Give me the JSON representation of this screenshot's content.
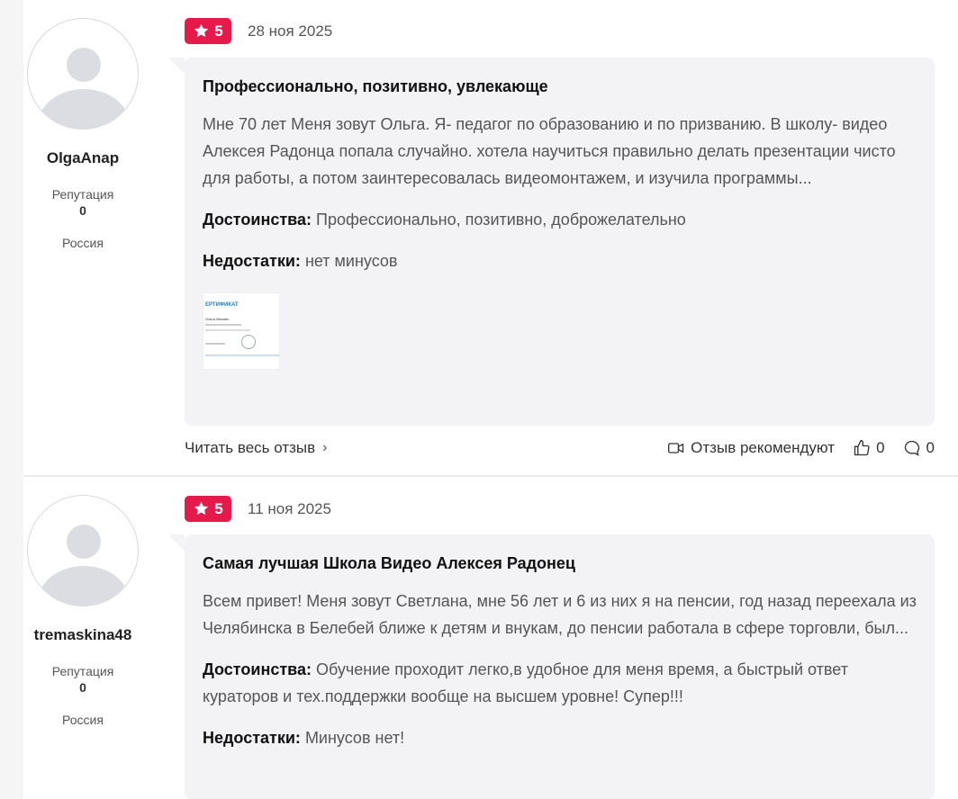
{
  "reviews": [
    {
      "username": "OlgaAnap",
      "reputation_label": "Репутация",
      "reputation_value": "0",
      "country": "Россия",
      "rating": "5",
      "date": "28 ноя 2025",
      "title": "Профессионально, позитивно, увлекающе",
      "text": "Мне 70 лет Меня зовут Ольга. Я- педагог по образованию и по призванию. В школу- видео Алексея Радонца попала случайно. хотела научиться правильно делать презентации чисто для работы, а потом заинтересовалась видеомонтажем, и изучила программы...",
      "pros_label": "Достоинства:",
      "pros": "Профессионально, позитивно, доброжелательно",
      "cons_label": "Недостатки:",
      "cons": "нет минусов",
      "attachment": {
        "heading": "ЕРТИФИКАТ",
        "name": "Ольга Михаил"
      },
      "footer": {
        "read_more": "Читать весь отзыв",
        "recommend_label": "Отзыв рекомендуют",
        "likes": "0",
        "comments": "0"
      }
    },
    {
      "username": "tremaskina48",
      "reputation_label": "Репутация",
      "reputation_value": "0",
      "country": "Россия",
      "rating": "5",
      "date": "11 ноя 2025",
      "title": "Самая лучшая Школа Видео Алексея Радонец",
      "text": "Всем привет! Меня зовут Светлана, мне 56 лет и 6 из них я на пенсии, год назад переехала из Челябинска в Белебей ближе к детям и внукам, до пенсии работала в сфере торговли, был...",
      "pros_label": "Достоинства:",
      "pros": "Обучение проходит легко,в удобное для меня время, а быстрый ответ кураторов и тех.поддержки вообще на высшем уровне! Супер!!!",
      "cons_label": "Недостатки:",
      "cons": "Минусов нет!"
    }
  ],
  "colors": {
    "badge": "#e6194b",
    "card_bg": "#f3f3f5",
    "page_bg": "#f5f5f5"
  },
  "icons": [
    "star-icon",
    "chevron-right-icon",
    "video-icon",
    "thumbs-up-icon",
    "comment-icon",
    "avatar-placeholder-icon"
  ]
}
